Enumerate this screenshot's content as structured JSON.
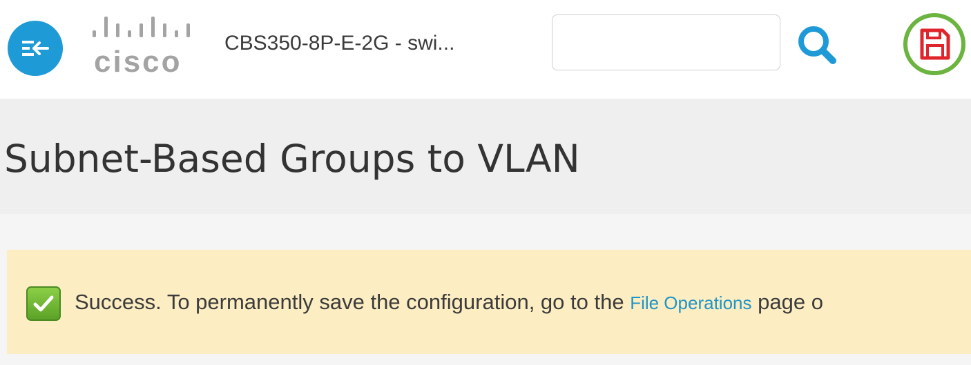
{
  "header": {
    "device_name": "CBS350-8P-E-2G - swi...",
    "logo_text": "cisco",
    "search": {
      "value": "",
      "placeholder": ""
    },
    "icons": {
      "menu_toggle": "collapse-menu-icon",
      "search": "search-icon",
      "save": "save-icon"
    }
  },
  "page": {
    "title": "Subnet-Based Groups to VLAN"
  },
  "message": {
    "status": "success",
    "text_before_link": "Success. To permanently save the configuration, go to the ",
    "link_label": "File Operations",
    "text_after_link": " page o",
    "icon": "check-icon"
  },
  "colors": {
    "accent_blue": "#1e9ad6",
    "link_blue": "#1f94c6",
    "save_red": "#e0242b",
    "highlight_green": "#6bb43f",
    "success_banner_bg": "#fcedc2",
    "title_band_bg": "#efefef",
    "check_green": "#6fb52c"
  }
}
